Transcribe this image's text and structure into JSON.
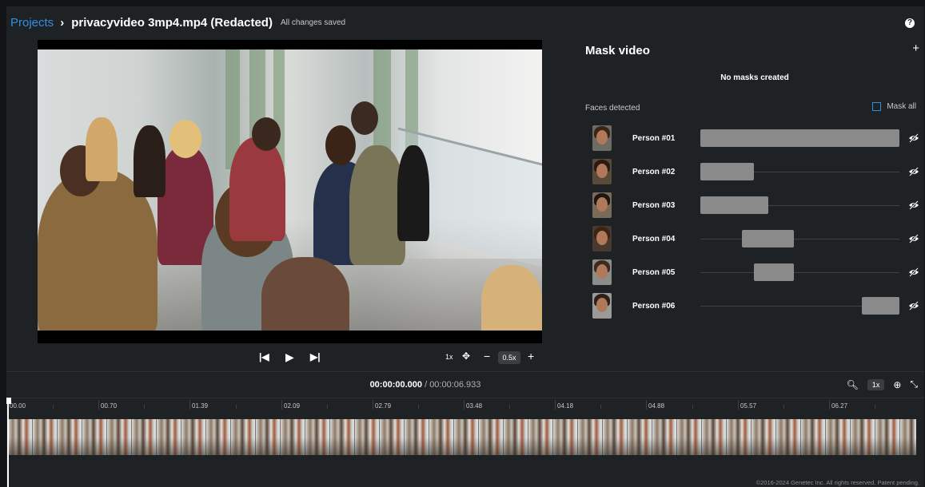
{
  "header": {
    "breadcrumb_link": "Projects",
    "title": "privacyvideo 3mp4.mp4 (Redacted)",
    "save_status": "All changes saved",
    "help_icon": "help-circle-icon"
  },
  "player": {
    "speed": "1x",
    "zoom": "0.5x",
    "icons": [
      "skip-back-icon",
      "play-icon",
      "skip-forward-icon",
      "move-icon",
      "zoom-out-icon",
      "zoom-in-icon"
    ]
  },
  "mask_panel": {
    "title": "Mask video",
    "add_icon": "plus-icon",
    "empty_text": "No masks created",
    "faces_label": "Faces detected",
    "mask_all_label": "Mask all",
    "accent_color": "#2f8fe5",
    "people": [
      {
        "label": "Person #01",
        "segment_start": 0.0,
        "segment_end": 1.0
      },
      {
        "label": "Person #02",
        "segment_start": 0.0,
        "segment_end": 0.27
      },
      {
        "label": "Person #03",
        "segment_start": 0.0,
        "segment_end": 0.34
      },
      {
        "label": "Person #04",
        "segment_start": 0.21,
        "segment_end": 0.47
      },
      {
        "label": "Person #05",
        "segment_start": 0.27,
        "segment_end": 0.47
      },
      {
        "label": "Person #06",
        "segment_start": 0.81,
        "segment_end": 1.0
      }
    ]
  },
  "timeline": {
    "current_time": "00:00:00.000",
    "separator": " / ",
    "total_time": "00:00:06.933",
    "zoom": "1x",
    "ticks": [
      "00.00",
      "00.70",
      "01.39",
      "02.09",
      "02.79",
      "03.48",
      "04.18",
      "04.88",
      "05.57",
      "06.27"
    ]
  },
  "footer": {
    "copyright": "©2016-2024 Genetec Inc. All rights reserved. Patent pending."
  }
}
